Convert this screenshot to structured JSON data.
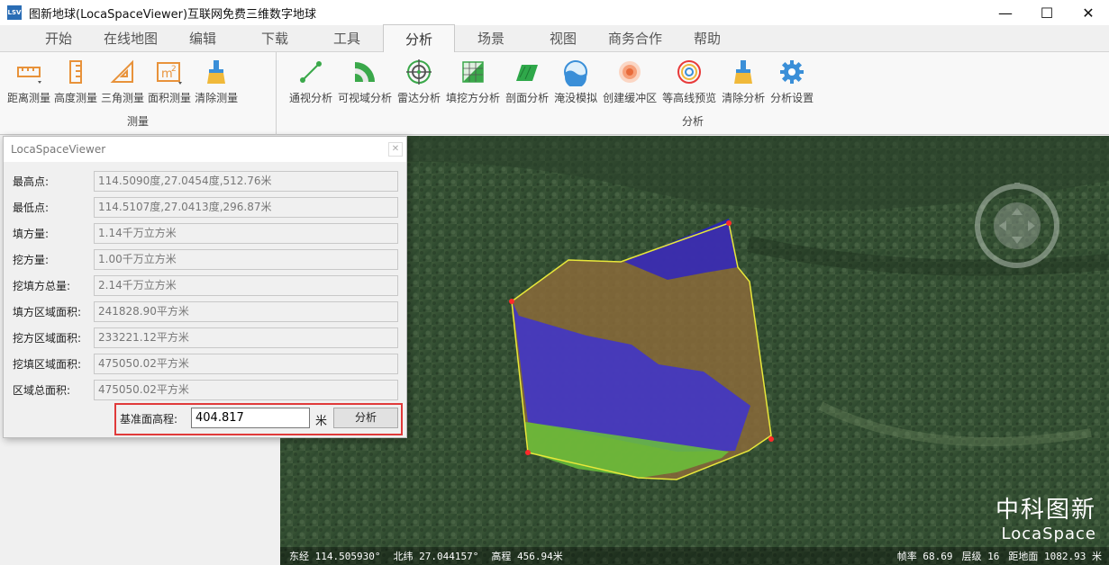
{
  "window": {
    "title": "图新地球(LocaSpaceViewer)互联网免费三维数字地球",
    "icon_text": "LSV"
  },
  "tabs": [
    "开始",
    "在线地图",
    "编辑",
    "下载",
    "工具",
    "分析",
    "场景",
    "视图",
    "商务合作",
    "帮助"
  ],
  "active_tab": "分析",
  "ribbon": {
    "measure_group": {
      "label": "测量",
      "items": [
        "距离测量",
        "高度测量",
        "三角测量",
        "面积测量",
        "清除测量"
      ]
    },
    "analysis_group": {
      "label": "分析",
      "items": [
        "通视分析",
        "可视域分析",
        "雷达分析",
        "填挖方分析",
        "剖面分析",
        "淹没模拟",
        "创建缓冲区",
        "等高线预览",
        "清除分析",
        "分析设置"
      ]
    }
  },
  "dialog": {
    "title": "LocaSpaceViewer",
    "rows": [
      {
        "label": "最高点:",
        "value": "114.5090度,27.0454度,512.76米"
      },
      {
        "label": "最低点:",
        "value": "114.5107度,27.0413度,296.87米"
      },
      {
        "label": "填方量:",
        "value": "1.14千万立方米"
      },
      {
        "label": "挖方量:",
        "value": "1.00千万立方米"
      },
      {
        "label": "挖填方总量:",
        "value": "2.14千万立方米"
      },
      {
        "label": "填方区域面积:",
        "value": "241828.90平方米"
      },
      {
        "label": "挖方区域面积:",
        "value": "233221.12平方米"
      },
      {
        "label": "挖填区域面积:",
        "value": "475050.02平方米"
      },
      {
        "label": "区域总面积:",
        "value": "475050.02平方米"
      }
    ],
    "baseline_label": "基准面高程:",
    "baseline_value": "404.817",
    "baseline_unit": "米",
    "analyze_button": "分析"
  },
  "status": {
    "lon": "东经 114.505930°",
    "lat": "北纬 27.044157°",
    "elev": "高程 456.94米",
    "fps": "帧率 68.69",
    "level": "层级 16",
    "ground": "距地面 1082.93 米"
  },
  "brand": {
    "cn": "中科图新",
    "en": "LocaSpace"
  },
  "colors": {
    "accent": "#2a6db5",
    "highlight": "#e03a3a",
    "fill_region": "#3a2fd9",
    "cut_region": "#8a6a3a",
    "green_region": "#6ac23a"
  }
}
